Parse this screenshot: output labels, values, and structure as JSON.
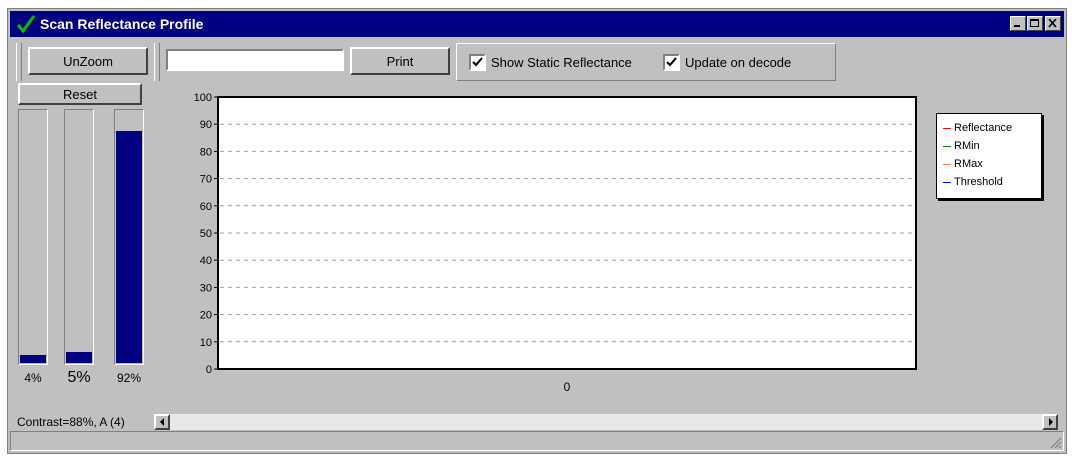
{
  "window": {
    "title": "Scan Reflectance Profile"
  },
  "toolbar": {
    "unzoom_label": "UnZoom",
    "input_value": "",
    "print_label": "Print",
    "show_static_label": "Show Static Reflectance",
    "show_static_checked": true,
    "update_decode_label": "Update on decode",
    "update_decode_checked": true
  },
  "left_panel": {
    "reset_label": "Reset",
    "bars": [
      {
        "label": "4%",
        "level_percent": 4
      },
      {
        "label": "5%",
        "level_percent": 5
      },
      {
        "label": "92%",
        "level_percent": 92
      }
    ],
    "contrast_text": "Contrast=88%, A (4)"
  },
  "colors": {
    "title_bar": "#000080",
    "bar_fill": "#000080",
    "reflectance": "#ff0000",
    "rmin": "#008000",
    "rmax": "#ff8040",
    "threshold": "#0000ff"
  },
  "chart_data": {
    "type": "line",
    "title": "",
    "xlabel": "",
    "ylabel": "",
    "ylim": [
      0,
      100
    ],
    "y_ticks": [
      "100",
      "90",
      "80",
      "70",
      "60",
      "50",
      "40",
      "30",
      "20",
      "10",
      "0"
    ],
    "x_ticks": [
      "0"
    ],
    "grid": true,
    "legend_placement": "right",
    "series": [
      {
        "name": "Reflectance",
        "values": []
      },
      {
        "name": "RMin",
        "values": []
      },
      {
        "name": "RMax",
        "values": []
      },
      {
        "name": "Threshold",
        "values": []
      }
    ]
  }
}
